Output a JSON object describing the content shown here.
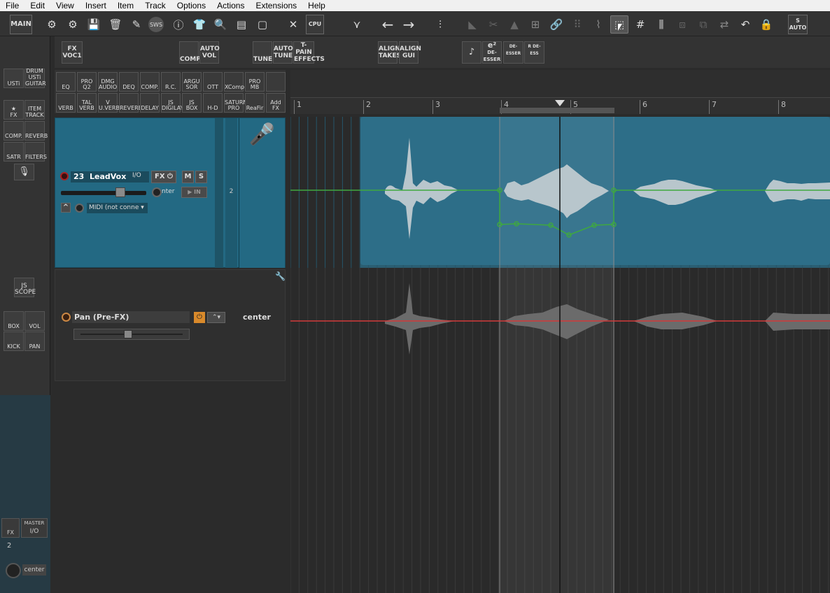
{
  "menu": [
    "File",
    "Edit",
    "View",
    "Insert",
    "Item",
    "Track",
    "Options",
    "Actions",
    "Extensions",
    "Help"
  ],
  "toolbar": {
    "main_label": "MAIN",
    "sws_label": "SWS",
    "cpu_label": "CPU",
    "auto_label": "AUTO",
    "s_label": "S"
  },
  "fxbar": {
    "fx_voc": [
      "FX",
      "VOC1"
    ],
    "comp": "COMP.",
    "auto_vol": [
      "AUTO",
      "VOL"
    ],
    "tune": "TUNE",
    "auto_tune": [
      "AUTO",
      "TUNE"
    ],
    "tpain": [
      "T-PAIN",
      "EFFECTS"
    ],
    "align_takes": [
      "ALIGN",
      "TAKES"
    ],
    "align_gui": [
      "ALIGN",
      "GUI"
    ],
    "e2": "e²",
    "deesser": "DE-ESSER",
    "de_esser": "DE-ESSER",
    "r_deess": "R DE-ESS"
  },
  "leftdock": {
    "usti": [
      "USTi"
    ],
    "drum": [
      "DRUM",
      "USTi",
      "GUITAR"
    ],
    "fx": "FX",
    "item": [
      "ITEM",
      "TRACK"
    ],
    "comp": "COMP.",
    "reverb": "REVERB",
    "satr": "SATR",
    "filters": "FILTERS",
    "js_scope": [
      "JS",
      "SCOPE"
    ],
    "box": "BOX",
    "vol": "VOL",
    "kick": "KICK",
    "pan": "PAN"
  },
  "plugins_row1": [
    [
      "",
      "EQ"
    ],
    [
      "PRO",
      "Q2"
    ],
    [
      "DMG",
      "AUDIO"
    ],
    [
      "",
      "DEQ"
    ],
    [
      "",
      "COMP."
    ],
    [
      "",
      "R.C."
    ],
    [
      "ARGU",
      "SOR"
    ],
    [
      "",
      "OTT"
    ],
    [
      "",
      "XComp"
    ],
    [
      "PRO",
      "MB"
    ],
    [
      "",
      ""
    ]
  ],
  "plugins_row2": [
    [
      "",
      "VERB"
    ],
    [
      "TAL",
      "VERB"
    ],
    [
      "V",
      "U.VERB"
    ],
    [
      "",
      "REVERB"
    ],
    [
      "",
      "DELAY"
    ],
    [
      "JS",
      "DIGILAY"
    ],
    [
      "JS",
      "BOX"
    ],
    [
      "",
      "H-D"
    ],
    [
      "SATURN",
      "PRO"
    ],
    [
      "",
      "ReaFir"
    ],
    [
      "Add",
      "FX"
    ]
  ],
  "ruler": [
    "1",
    "2",
    "3",
    "4",
    "5",
    "6",
    "7",
    "8"
  ],
  "track": {
    "number": "23",
    "name": "LeadVox",
    "io": "I/O",
    "fx": "FX",
    "mute": "M",
    "solo": "S",
    "pan_label": "nter",
    "in_label": "IN",
    "midi": "MIDI (not conne",
    "tcp_num": "2"
  },
  "envelope": {
    "name": "Pan (Pre-FX)",
    "value": "center"
  },
  "mcp": {
    "master": "MASTER",
    "io": "I/O",
    "fx": "FX",
    "num": "2",
    "pan": "center"
  },
  "colors": {
    "track": "#236983",
    "item": "#2d6e88",
    "env_green": "#3fa83f",
    "env_red": "#d23a3a"
  }
}
